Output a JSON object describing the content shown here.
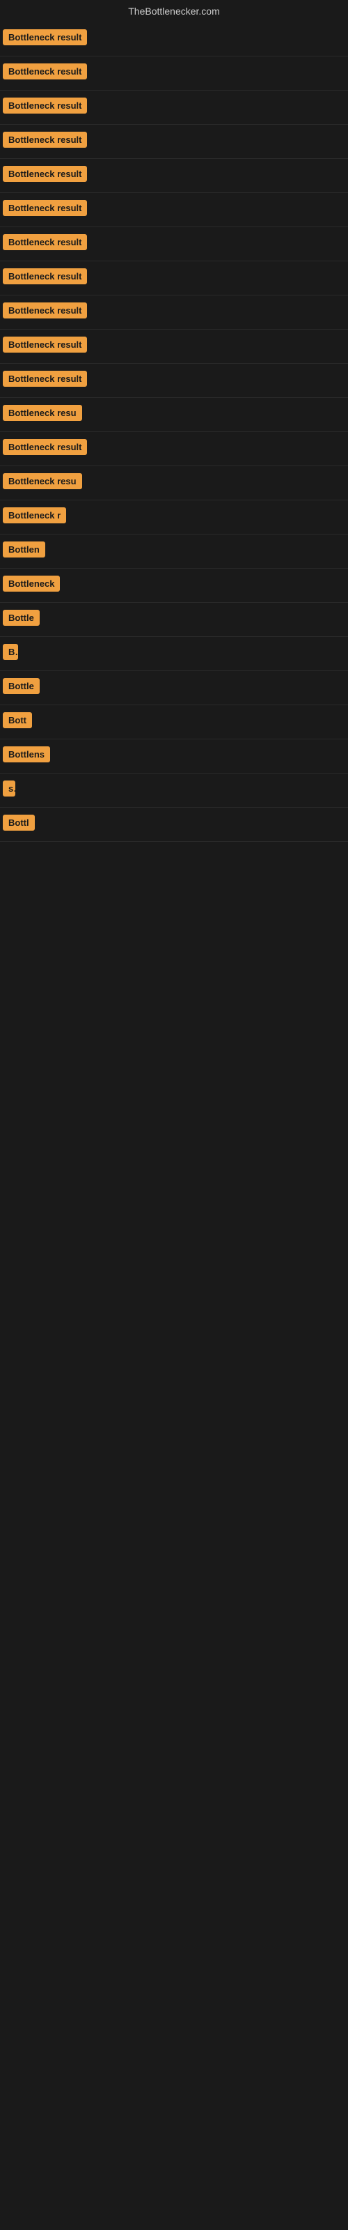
{
  "site": {
    "title": "TheBottlenecker.com"
  },
  "results": [
    {
      "id": 1,
      "label": "Bottleneck result",
      "width": 170
    },
    {
      "id": 2,
      "label": "Bottleneck result",
      "width": 170
    },
    {
      "id": 3,
      "label": "Bottleneck result",
      "width": 170
    },
    {
      "id": 4,
      "label": "Bottleneck result",
      "width": 170
    },
    {
      "id": 5,
      "label": "Bottleneck result",
      "width": 170
    },
    {
      "id": 6,
      "label": "Bottleneck result",
      "width": 170
    },
    {
      "id": 7,
      "label": "Bottleneck result",
      "width": 170
    },
    {
      "id": 8,
      "label": "Bottleneck result",
      "width": 170
    },
    {
      "id": 9,
      "label": "Bottleneck result",
      "width": 170
    },
    {
      "id": 10,
      "label": "Bottleneck result",
      "width": 170
    },
    {
      "id": 11,
      "label": "Bottleneck result",
      "width": 170
    },
    {
      "id": 12,
      "label": "Bottleneck resu",
      "width": 150
    },
    {
      "id": 13,
      "label": "Bottleneck result",
      "width": 155
    },
    {
      "id": 14,
      "label": "Bottleneck resu",
      "width": 140
    },
    {
      "id": 15,
      "label": "Bottleneck r",
      "width": 110
    },
    {
      "id": 16,
      "label": "Bottlen",
      "width": 75
    },
    {
      "id": 17,
      "label": "Bottleneck",
      "width": 90
    },
    {
      "id": 18,
      "label": "Bottle",
      "width": 62
    },
    {
      "id": 19,
      "label": "B",
      "width": 22
    },
    {
      "id": 20,
      "label": "Bottle",
      "width": 62
    },
    {
      "id": 21,
      "label": "Bott",
      "width": 45
    },
    {
      "id": 22,
      "label": "Bottlens",
      "width": 78
    },
    {
      "id": 23,
      "label": "s",
      "width": 18
    },
    {
      "id": 24,
      "label": "Bottl",
      "width": 52
    }
  ]
}
